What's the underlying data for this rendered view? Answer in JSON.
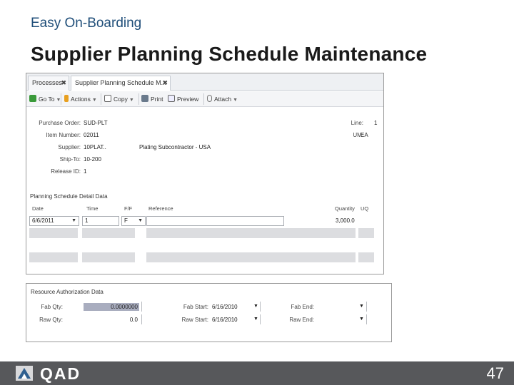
{
  "slide": {
    "kicker": "Easy On-Boarding",
    "title": "Supplier Planning Schedule Maintenance",
    "page_number": "47",
    "brand": "QAD"
  },
  "tabs": [
    {
      "label": "Processes",
      "close": "✖"
    },
    {
      "label": "Supplier Planning Schedule M...",
      "close": "✖"
    }
  ],
  "toolbar": {
    "go_to": "Go To",
    "actions": "Actions",
    "copy": "Copy",
    "print": "Print",
    "preview": "Preview",
    "attach": "Attach"
  },
  "header_fields": {
    "purchase_order_label": "Purchase Order:",
    "purchase_order_value": "SUD-PLT",
    "item_number_label": "Item Number:",
    "item_number_value": "02011",
    "supplier_label": "Supplier:",
    "supplier_value": "10PLAT..",
    "supplier_name": "Plating Subcontractor - USA",
    "ship_to_label": "Ship-To:",
    "ship_to_value": "10-200",
    "release_id_label": "Release ID:",
    "release_id_value": "1",
    "line_label": "Line:",
    "line_value": "1",
    "um_label": "UM:",
    "um_value": "EA"
  },
  "detail": {
    "section_label": "Planning Schedule Detail Data",
    "columns": {
      "date": "Date",
      "time": "Time",
      "ff": "F/F",
      "reference": "Reference",
      "quantity": "Quantity",
      "uq": "UQ"
    },
    "row": {
      "date": "6/6/2011",
      "time": "1",
      "ff": "F",
      "reference": "",
      "quantity": "3,000.0",
      "uq": ""
    }
  },
  "authorization": {
    "section_label": "Resource Authorization Data",
    "fab_qty_label": "Fab Qty:",
    "fab_qty_value": "0.0000000",
    "raw_qty_label": "Raw Qty:",
    "raw_qty_value": "0.0",
    "fab_start_label": "Fab Start:",
    "fab_start_value": "6/16/2010",
    "raw_start_label": "Raw Start:",
    "raw_start_value": "6/16/2010",
    "fab_end_label": "Fab End:",
    "fab_end_value": "",
    "raw_end_label": "Raw End:",
    "raw_end_value": ""
  },
  "icons": {
    "dropdown": "▼",
    "combo": "▼"
  },
  "colors": {
    "footer": "#57585b",
    "kicker": "#1f4e79",
    "highlight_field": "#a9adbf"
  }
}
